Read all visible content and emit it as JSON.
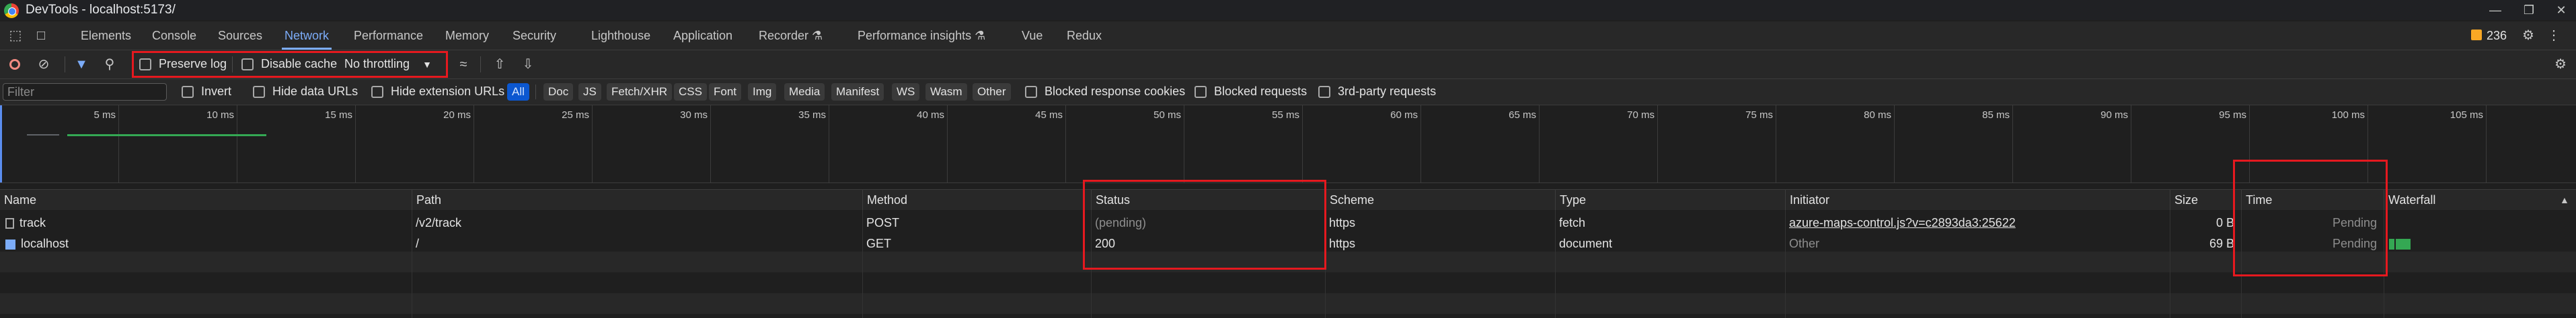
{
  "window": {
    "title": "DevTools - localhost:5173/",
    "controls": [
      "minimize",
      "restore",
      "close"
    ]
  },
  "tabs": [
    {
      "label": "Elements"
    },
    {
      "label": "Console"
    },
    {
      "label": "Sources"
    },
    {
      "label": "Network",
      "active": true
    },
    {
      "label": "Performance"
    },
    {
      "label": "Memory"
    },
    {
      "label": "Security"
    },
    {
      "label": "Lighthouse"
    },
    {
      "label": "Application"
    },
    {
      "label": "Recorder ⚗"
    },
    {
      "label": "Performance insights ⚗"
    },
    {
      "label": "Vue"
    },
    {
      "label": "Redux"
    }
  ],
  "issues": {
    "count": "236"
  },
  "network_toolbar": {
    "preserve_log": {
      "label": "Preserve log",
      "checked": false
    },
    "disable_cache": {
      "label": "Disable cache",
      "checked": false
    },
    "throttling": {
      "value": "No throttling"
    }
  },
  "filter_bar": {
    "filter_placeholder": "Filter",
    "invert": {
      "label": "Invert",
      "checked": false
    },
    "hide_data_urls": {
      "label": "Hide data URLs",
      "checked": false
    },
    "hide_extension_urls": {
      "label": "Hide extension URLs",
      "checked": false
    },
    "types": [
      "All",
      "Doc",
      "JS",
      "Fetch/XHR",
      "CSS",
      "Font",
      "Img",
      "Media",
      "Manifest",
      "WS",
      "Wasm",
      "Other"
    ],
    "active_type": "All",
    "blocked_response_cookies": {
      "label": "Blocked response cookies",
      "checked": false
    },
    "blocked_requests": {
      "label": "Blocked requests",
      "checked": false
    },
    "third_party": {
      "label": "3rd-party requests",
      "checked": false
    }
  },
  "overview": {
    "ticks": [
      "5 ms",
      "10 ms",
      "15 ms",
      "20 ms",
      "25 ms",
      "30 ms",
      "35 ms",
      "40 ms",
      "45 ms",
      "50 ms",
      "55 ms",
      "60 ms",
      "65 ms",
      "70 ms",
      "75 ms",
      "80 ms",
      "85 ms",
      "90 ms",
      "95 ms",
      "100 ms",
      "105 ms"
    ],
    "colors": {
      "waiting": "#34a853",
      "bar": "#5f6368"
    }
  },
  "table": {
    "columns": [
      "Name",
      "Path",
      "Method",
      "Status",
      "Scheme",
      "Type",
      "Initiator",
      "Size",
      "Time",
      "Waterfall"
    ],
    "rows": [
      {
        "name": "track",
        "path": "/v2/track",
        "method": "POST",
        "status": "(pending)",
        "scheme": "https",
        "type": "fetch",
        "initiator": "azure-maps-control.js?v=c2893da3:25622",
        "size": "0 B",
        "time": "Pending"
      },
      {
        "name": "localhost",
        "path": "/",
        "method": "GET",
        "status": "200",
        "scheme": "https",
        "type": "document",
        "initiator": "Other",
        "size": "69 B",
        "time": "Pending"
      }
    ]
  },
  "highlight_color": "#e5191f",
  "accent_color": "#7cacf8"
}
